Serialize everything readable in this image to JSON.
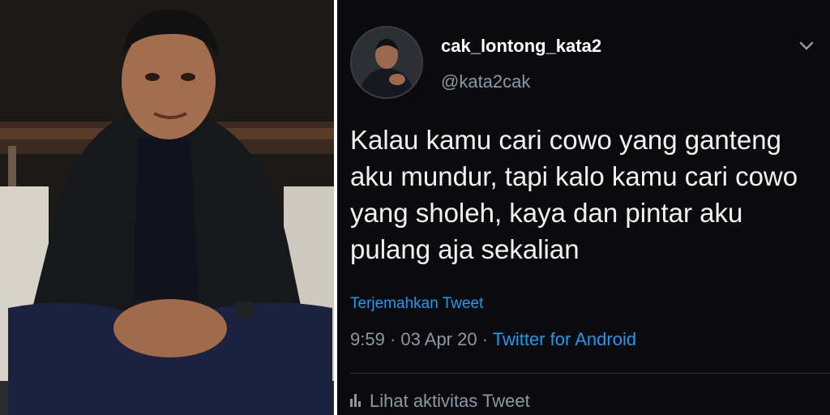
{
  "tweet": {
    "display_name": "cak_lontong_kata2",
    "handle": "@kata2cak",
    "text": "Kalau kamu cari cowo yang ganteng aku mundur, tapi kalo kamu cari cowo yang sholeh, kaya dan pintar aku pulang aja sekalian",
    "translate_label": "Terjemahkan Tweet",
    "time": "9:59",
    "date": "03 Apr 20",
    "separator": "·",
    "source": "Twitter for Android",
    "activity_label": "Lihat aktivitas Tweet",
    "menu_icon": "chevron-down-icon",
    "activity_icon": "bar-chart-icon"
  },
  "colors": {
    "background": "#0b0b0d",
    "link": "#1d9bf0",
    "secondary_text": "#8b98a5",
    "primary_text": "#f2f2f2"
  }
}
